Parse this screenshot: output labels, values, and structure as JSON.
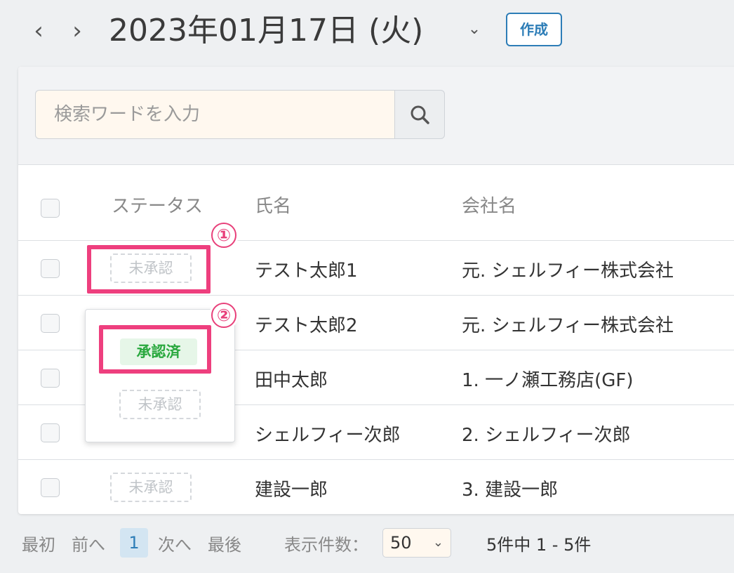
{
  "header": {
    "prev_icon": "chevron-left-icon",
    "next_icon": "chevron-right-icon",
    "date": "2023年01月17日 (火)",
    "dropdown_icon": "chevron-down-icon",
    "create_label": "作成"
  },
  "search": {
    "placeholder": "検索ワードを入力",
    "icon": "search-icon"
  },
  "table": {
    "columns": [
      "ステータス",
      "氏名",
      "会社名"
    ],
    "rows": [
      {
        "status": "未承認",
        "name": "テスト太郎1",
        "company": "元. シェルフィー株式会社"
      },
      {
        "status": "",
        "name": "テスト太郎2",
        "company": "元. シェルフィー株式会社"
      },
      {
        "status": "",
        "name": "田中太郎",
        "company": "1. 一ノ瀬工務店(GF)"
      },
      {
        "status": "",
        "name": "シェルフィー次郎",
        "company": "2. シェルフィー次郎"
      },
      {
        "status": "未承認",
        "name": "建設一郎",
        "company": "3. 建設一郎"
      }
    ]
  },
  "status_popup": {
    "options": [
      "承認済",
      "未承認"
    ]
  },
  "annotations": {
    "one": "①",
    "two": "②"
  },
  "pagination": {
    "first": "最初",
    "prev": "前へ",
    "current": "1",
    "next": "次へ",
    "last": "最後",
    "per_page_label": "表示件数：",
    "per_page_value": "50",
    "summary": "5件中 1 - 5件"
  },
  "colors": {
    "accent": "#2d7db7",
    "highlight": "#ee3f7e",
    "approved": "#29a83e"
  }
}
